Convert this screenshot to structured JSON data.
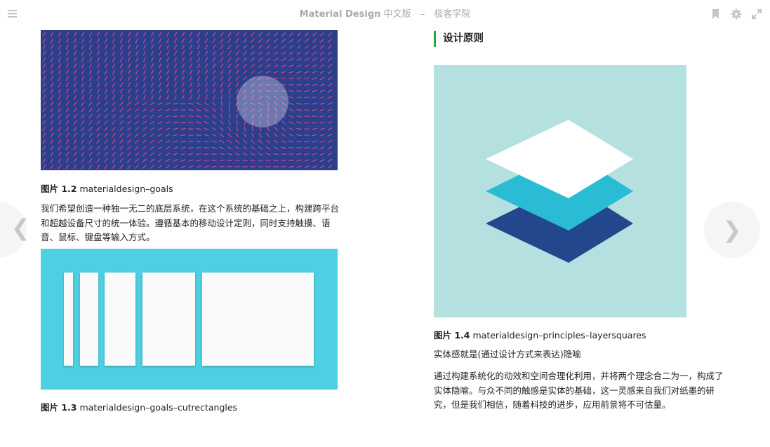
{
  "header": {
    "book_title": "Material Design",
    "book_subtitle": "中文版",
    "separator": "–",
    "publisher": "极客学院"
  },
  "toolbar": {
    "menu_icon": "menu-icon",
    "bookmark_icon": "bookmark-icon",
    "settings_icon": "gear-icon",
    "fullscreen_icon": "expand-icon"
  },
  "nav": {
    "prev_glyph": "❮",
    "next_glyph": "❯"
  },
  "left_page": {
    "figure_1_2": {
      "label": "图片 1.2",
      "name": "materialdesign–goals"
    },
    "paragraph": "我们希望创造一种独一无二的底层系统，在这个系统的基础之上，构建跨平台和超越设备尺寸的统一体验。遵循基本的移动设计定则，同时支持触摸、语音、鼠标、键盘等输入方式。",
    "figure_1_3": {
      "label": "图片 1.3",
      "name": "materialdesign–goals–cutrectangles"
    }
  },
  "right_page": {
    "heading": "设计原则",
    "figure_1_4": {
      "label": "图片 1.4",
      "name": "materialdesign–principles–layersquares"
    },
    "paragraph_1": "实体感就是(通过设计方式来表达)隐喻",
    "paragraph_2": "通过构建系统化的动效和空间合理化利用，并将两个理念合二为一，构成了实体隐喻。与众不同的触感是实体的基础，这一灵感来自我们对纸墨的研究，但是我们相信，随着科技的进步，应用前景将不可估量。"
  },
  "colors": {
    "accent_green": "#28a745",
    "goals_bg": "#2b3f8c",
    "goals_dash": "#d94a8c",
    "cutrect_bg": "#4fd0e2",
    "layers_bg": "#b5e0e0",
    "layer_top": "#ffffff",
    "layer_mid": "#29bcd4",
    "layer_bottom": "#23478c"
  }
}
